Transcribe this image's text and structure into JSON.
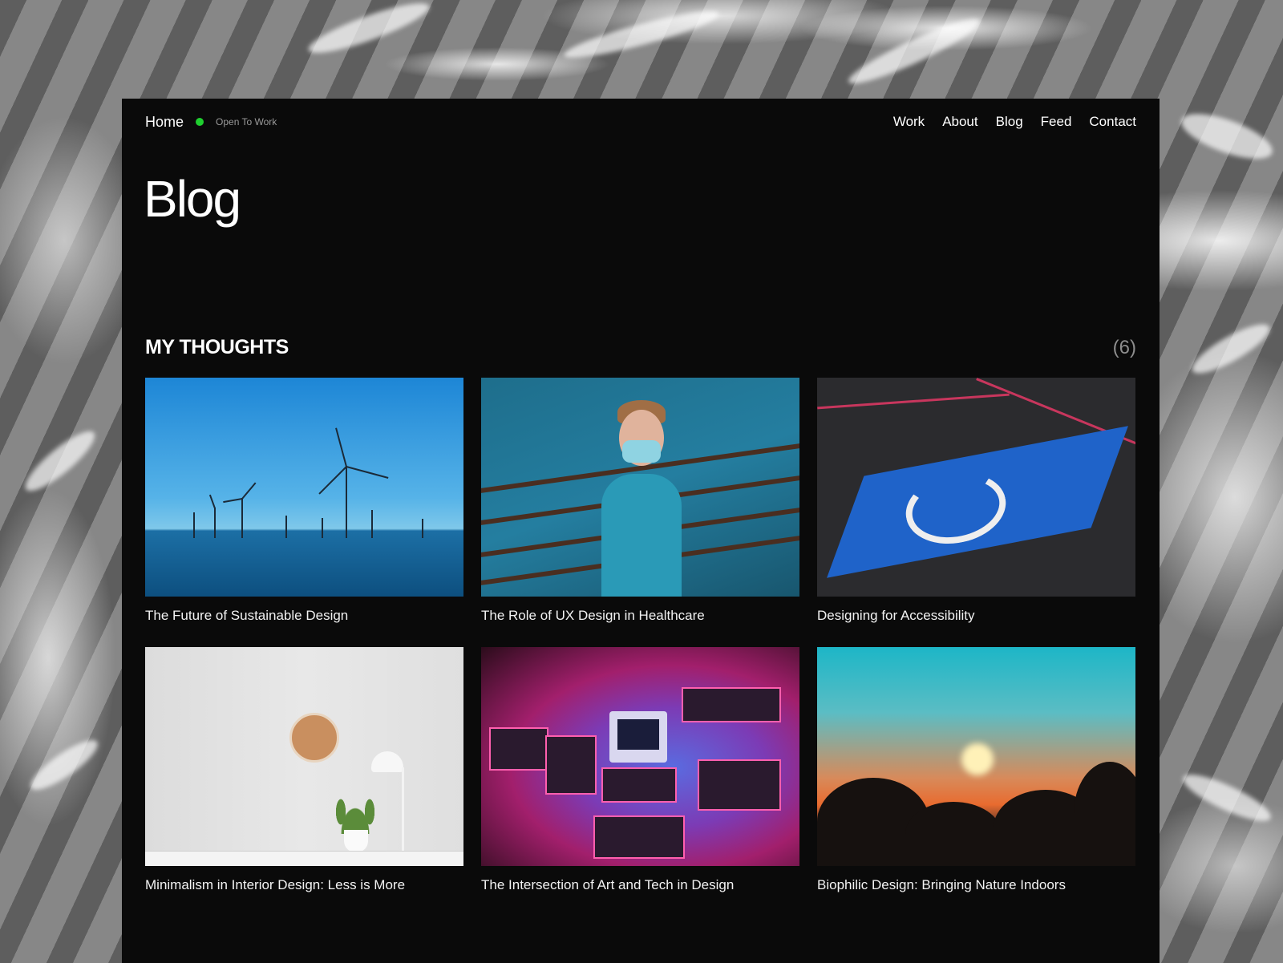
{
  "header": {
    "home_label": "Home",
    "status_label": "Open To Work",
    "status_color": "#1fcf2f",
    "nav": [
      "Work",
      "About",
      "Blog",
      "Feed",
      "Contact"
    ]
  },
  "page_title": "Blog",
  "section": {
    "title": "MY THOUGHTS",
    "count": "(6)"
  },
  "posts": [
    {
      "title": "The Future of Sustainable Design",
      "image": "offshore-wind-turbines"
    },
    {
      "title": "The Role of UX Design in Healthcare",
      "image": "masked-nurse"
    },
    {
      "title": "Designing for Accessibility",
      "image": "accessibility-parking-sign"
    },
    {
      "title": "Minimalism in Interior Design: Less is More",
      "image": "minimal-room-clock-plant-lamp"
    },
    {
      "title": "The Intersection of Art and Tech in Design",
      "image": "retro-computers-neon"
    },
    {
      "title": "Biophilic Design: Bringing Nature Indoors",
      "image": "sunset-plants"
    }
  ]
}
